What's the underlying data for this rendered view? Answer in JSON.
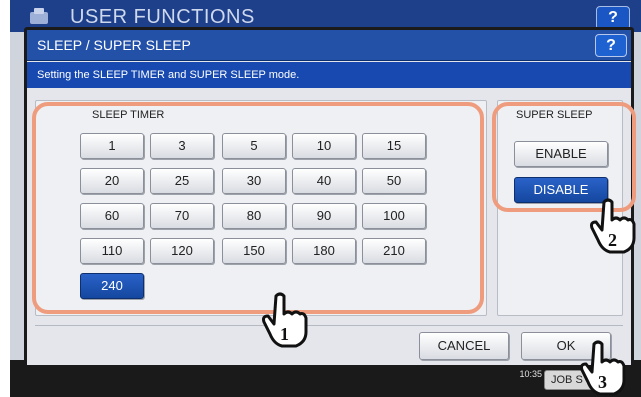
{
  "background_window": {
    "title": "USER FUNCTIONS",
    "help_label": "?",
    "clock_date": "",
    "clock_time": "10:35",
    "job_label": "JOB S"
  },
  "dialog": {
    "title": "SLEEP / SUPER SLEEP",
    "help_label": "?",
    "message": "Setting the SLEEP TIMER and SUPER SLEEP mode.",
    "sleep_timer": {
      "label": "SLEEP TIMER",
      "options": [
        "1",
        "3",
        "5",
        "10",
        "15",
        "20",
        "25",
        "30",
        "40",
        "50",
        "60",
        "70",
        "80",
        "90",
        "100",
        "110",
        "120",
        "150",
        "180",
        "210",
        "240"
      ],
      "selected": "240"
    },
    "super_sleep": {
      "label": "SUPER SLEEP",
      "enable_label": "ENABLE",
      "disable_label": "DISABLE",
      "selected": "DISABLE"
    },
    "cancel_label": "CANCEL",
    "ok_label": "OK"
  },
  "annotations": {
    "step1": "1",
    "step2": "2",
    "step3": "3",
    "highlight_color": "#ef9c7e"
  },
  "colors": {
    "title_bar": "#2451a8",
    "message_bar": "#1749b0",
    "selected_button": "#1a4fb0"
  }
}
